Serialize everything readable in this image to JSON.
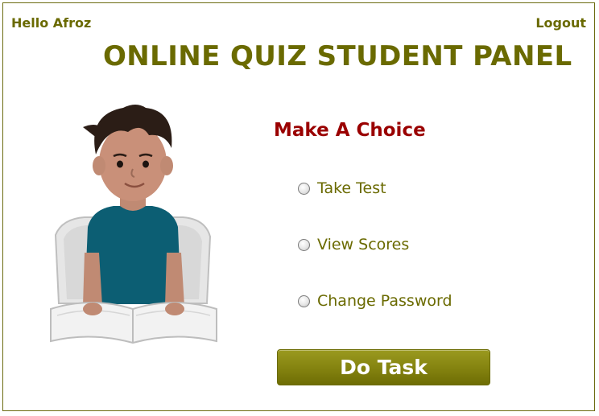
{
  "header": {
    "greeting": "Hello Afroz",
    "logout_label": "Logout"
  },
  "page": {
    "title": "ONLINE QUIZ STUDENT PANEL"
  },
  "choice": {
    "heading": "Make A Choice",
    "options": [
      {
        "label": "Take Test",
        "selected": false
      },
      {
        "label": "View Scores",
        "selected": false
      },
      {
        "label": "Change Password",
        "selected": false
      }
    ]
  },
  "actions": {
    "do_task_label": "Do Task"
  },
  "colors": {
    "primary_olive": "#6a6a00",
    "heading_red": "#9a0000",
    "button_olive": "#83820f"
  },
  "icons": {
    "student_illustration": "student-reading-book",
    "radio": "radio-button-unchecked"
  }
}
